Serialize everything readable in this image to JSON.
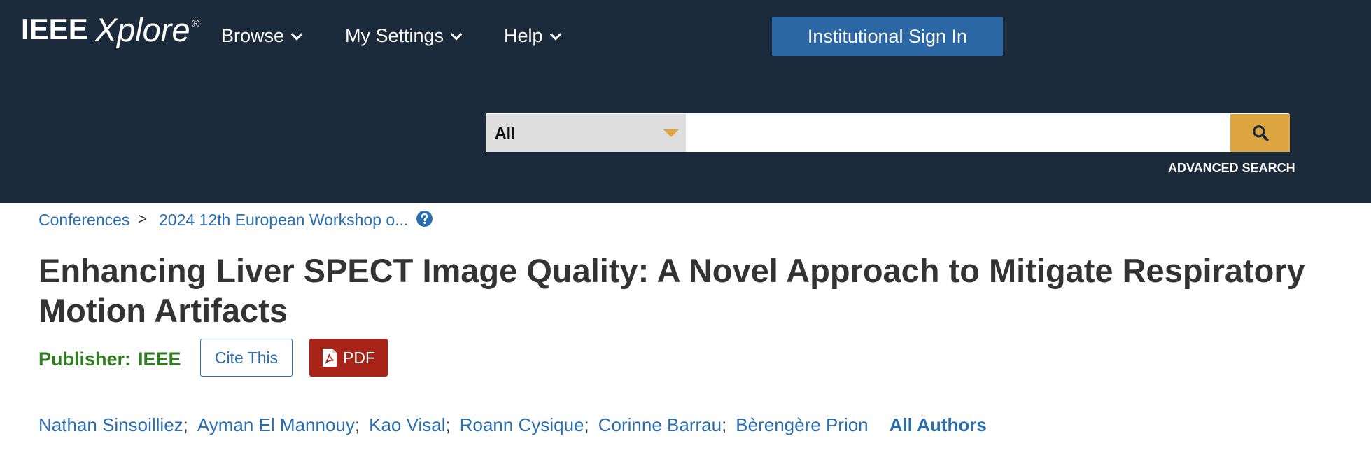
{
  "header": {
    "logo": {
      "brand": "IEEE",
      "product": "Xplore",
      "reg": "®"
    },
    "nav": [
      {
        "label": "Browse"
      },
      {
        "label": "My Settings"
      },
      {
        "label": "Help"
      }
    ],
    "signin_label": "Institutional Sign In",
    "search": {
      "scope": "All",
      "placeholder": "",
      "value": "",
      "button_icon": "search-icon"
    },
    "advanced_label": "ADVANCED SEARCH"
  },
  "breadcrumb": {
    "items": [
      "Conferences",
      "2024 12th European Workshop o..."
    ],
    "separator": ">",
    "help_icon": "question-circle-icon"
  },
  "article": {
    "title_line1": "Enhancing Liver SPECT Image Quality: A Novel Approach to Mitigate Respiratory",
    "title_line2": "Motion Artifacts",
    "publisher_label": "Publisher:",
    "publisher_value": "IEEE",
    "cite_label": "Cite This",
    "pdf_label": "PDF",
    "authors": [
      "Nathan Sinsoilliez",
      "Ayman El Mannouy",
      "Kao Visal",
      "Roann Cysique",
      "Corinne Barrau",
      "Bèrengère Prion"
    ],
    "author_separator": ";",
    "all_authors_label": "All Authors"
  },
  "colors": {
    "header_bg": "#1c2b3b",
    "signin_bg": "#2b66a5",
    "search_button": "#dea640",
    "link": "#2a6eb0",
    "publisher": "#2e7d1f",
    "pdf_bg": "#a82318"
  }
}
